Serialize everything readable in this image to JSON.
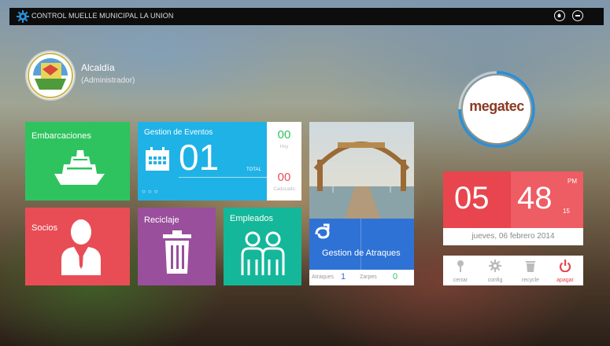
{
  "window": {
    "title": "CONTROL MUELLE MUNICIPAL LA UNION"
  },
  "user": {
    "name": "Alcaldía",
    "role": "(Administrador)"
  },
  "brand": {
    "logo_text": "megatec"
  },
  "tiles": {
    "embarcaciones": {
      "label": "Embarcaciones",
      "color": "#2ec35e"
    },
    "eventos": {
      "label": "Gestion de Eventos",
      "count": "01",
      "total_label": "TOTAL",
      "today_count": "00",
      "today_label": "Hoy",
      "expired_count": "00",
      "expired_label": "Caducado",
      "color": "#1fb2e6"
    },
    "atraques": {
      "label": "Gestion de Atraques",
      "atraques_label": "Atraques",
      "atraques_value": "1",
      "zarpes_label": "Zarpes",
      "zarpes_value": "0",
      "color": "#2f72d6"
    },
    "socios": {
      "label": "Socios",
      "color": "#e84d56"
    },
    "reciclaje": {
      "label": "Reciclaje",
      "color": "#9a4f9c"
    },
    "empleados": {
      "label": "Empleados",
      "color": "#15b79a"
    }
  },
  "clock": {
    "hour": "05",
    "minute": "48",
    "second": "15",
    "ampm": "PM",
    "date": "jueves, 06 febrero 2014",
    "color": "#e8454f"
  },
  "tools": [
    {
      "label": "cerrar",
      "icon": "pin-icon"
    },
    {
      "label": "config",
      "icon": "gear-icon"
    },
    {
      "label": "recycle",
      "icon": "trash-icon"
    },
    {
      "label": "apagar",
      "icon": "power-icon"
    }
  ]
}
